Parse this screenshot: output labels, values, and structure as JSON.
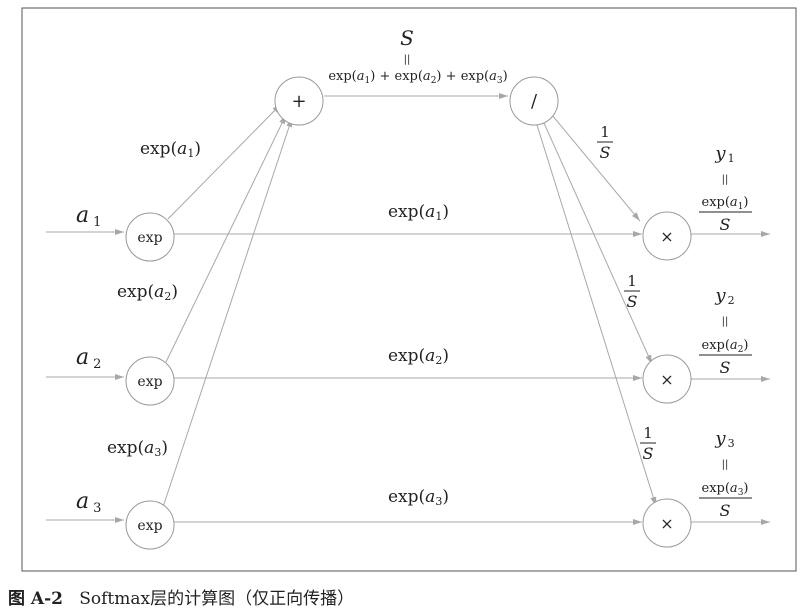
{
  "nodes": {
    "exp1": "exp",
    "exp2": "exp",
    "exp3": "exp",
    "plus": "+",
    "div": "/",
    "mul1": "×",
    "mul2": "×",
    "mul3": "×"
  },
  "inputs": {
    "a1": {
      "var": "a",
      "sub": "1"
    },
    "a2": {
      "var": "a",
      "sub": "2"
    },
    "a3": {
      "var": "a",
      "sub": "3"
    }
  },
  "edge_labels": {
    "diag1": {
      "pre": "exp(",
      "var": "a",
      "sub": "1",
      "post": ")"
    },
    "diag2": {
      "pre": "exp(",
      "var": "a",
      "sub": "2",
      "post": ")"
    },
    "diag3": {
      "pre": "exp(",
      "var": "a",
      "sub": "3",
      "post": ")"
    },
    "row1": {
      "pre": "exp(",
      "var": "a",
      "sub": "1",
      "post": ")"
    },
    "row2": {
      "pre": "exp(",
      "var": "a",
      "sub": "2",
      "post": ")"
    },
    "row3": {
      "pre": "exp(",
      "var": "a",
      "sub": "3",
      "post": ")"
    }
  },
  "sum": {
    "symbol": "S",
    "equals": "||",
    "terms": [
      {
        "pre": "exp(",
        "var": "a",
        "sub": "1",
        "post": ")"
      },
      {
        "pre": "exp(",
        "var": "a",
        "sub": "2",
        "post": ")"
      },
      {
        "pre": "exp(",
        "var": "a",
        "sub": "3",
        "post": ")"
      }
    ],
    "plus": "+"
  },
  "reciprocal": {
    "numerator": "1",
    "denominator": "S"
  },
  "outputs": [
    {
      "var": "y",
      "sub": "1",
      "equals": "||",
      "num_pre": "exp(",
      "num_var": "a",
      "num_sub": "1",
      "num_post": ")",
      "den": "S"
    },
    {
      "var": "y",
      "sub": "2",
      "equals": "||",
      "num_pre": "exp(",
      "num_var": "a",
      "num_sub": "2",
      "num_post": ")",
      "den": "S"
    },
    {
      "var": "y",
      "sub": "3",
      "equals": "||",
      "num_pre": "exp(",
      "num_var": "a",
      "num_sub": "3",
      "num_post": ")",
      "den": "S"
    }
  ],
  "caption": {
    "label": "图 A-2",
    "text": "Softmax层的计算图（仅正向传播）"
  }
}
